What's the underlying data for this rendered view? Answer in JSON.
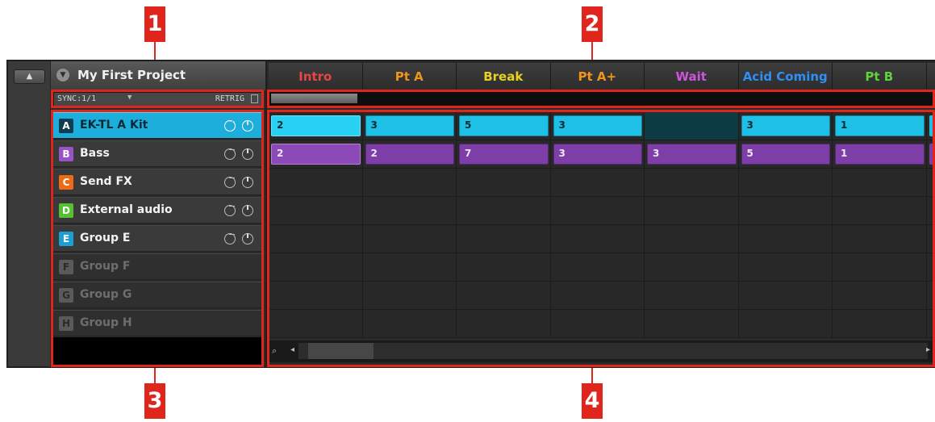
{
  "callouts": [
    "1",
    "2",
    "3",
    "4"
  ],
  "collapse_button": {
    "icon": "arrow-up-icon",
    "glyph": "▲"
  },
  "project": {
    "title": "My First Project",
    "icon_glyph": "▼"
  },
  "sync": {
    "label": "SYNC:1/1",
    "arrow": "▼",
    "retrig_label": "RETRIG"
  },
  "groups": [
    {
      "letter": "A",
      "name": "EK-TL A Kit",
      "color": "#1eaedb",
      "selected": true,
      "enabled": true
    },
    {
      "letter": "B",
      "name": "Bass",
      "color": "#9b52c7",
      "selected": false,
      "enabled": true
    },
    {
      "letter": "C",
      "name": "Send FX",
      "color": "#ee6a14",
      "selected": false,
      "enabled": true
    },
    {
      "letter": "D",
      "name": "External audio",
      "color": "#54c22e",
      "selected": false,
      "enabled": true
    },
    {
      "letter": "E",
      "name": "Group E",
      "color": "#1e9fd4",
      "selected": false,
      "enabled": true
    },
    {
      "letter": "F",
      "name": "Group F",
      "color": "#5a5a5a",
      "selected": false,
      "enabled": false
    },
    {
      "letter": "G",
      "name": "Group G",
      "color": "#5a5a5a",
      "selected": false,
      "enabled": false
    },
    {
      "letter": "H",
      "name": "Group H",
      "color": "#5a5a5a",
      "selected": false,
      "enabled": false
    }
  ],
  "sections": [
    {
      "name": "Intro",
      "color": "#e84545"
    },
    {
      "name": "Pt A",
      "color": "#f0951a"
    },
    {
      "name": "Break",
      "color": "#e8d120"
    },
    {
      "name": "Pt A+",
      "color": "#f0951a"
    },
    {
      "name": "Wait",
      "color": "#cc55dd"
    },
    {
      "name": "Acid Coming",
      "color": "#2f8ff2"
    },
    {
      "name": "Pt B",
      "color": "#5ed33a"
    }
  ],
  "patterns": {
    "row_a": [
      "2",
      "3",
      "5",
      "3",
      "",
      "3",
      "1"
    ],
    "row_b": [
      "2",
      "2",
      "7",
      "3",
      "3",
      "5",
      "1"
    ]
  },
  "colors": {
    "pattern_a": "#1ec0e6",
    "pattern_a_selected": "#29d2f5",
    "pattern_b": "#7e3ea8",
    "pattern_b_first": "#8c4ab8",
    "callout": "#e0261c"
  },
  "scrollbar": {
    "zoom_icon": "⌕",
    "left_icon": "◂",
    "right_icon": "▸"
  }
}
